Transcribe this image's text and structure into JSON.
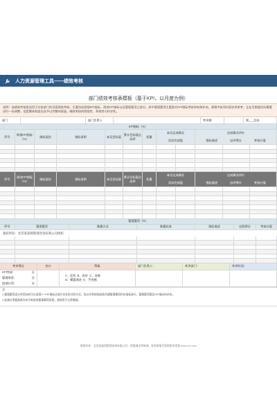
{
  "header": {
    "title": "人力资源管理工具——绩效考核"
  },
  "doc": {
    "title": "部门绩效考核表模板（基于KPI，以月度为例）",
    "description": "说明：该绩效考核表适用于对各部门的月度绩效考核，主要包括常规KPI指标、改进KPI指标以及管理要项三部分，其中管理要项主要是对KPI指标考核的有效补充。表格中各项内容仅供参考，企业可根据实际需要进行一些调整，但是整体框架应该予以完整的保留，确保考核的简规性、系统性与科学性。",
    "info_labels": [
      "部门",
      "部门负责人",
      "考评期",
      "第___月份"
    ],
    "kpi_band": "KPI指标（%）",
    "kpi_cols": [
      "序号",
      "常规KPI指标（%）",
      "指标类别",
      "指标说明",
      "本月目标值",
      "累计目标值达成率",
      "权重",
      "本月达成情况",
      "实际完成值",
      "本期完成值比率（%）",
      "达成情况评价",
      "指标描述",
      "自评得分",
      "考核分值"
    ],
    "kpi_group": "本月达成情况",
    "eval_group": "达成情况评价",
    "improve_first": "改进KPI指标（%）",
    "mgmt_band": "管理要项（%）",
    "mgmt_cols": [
      "序号",
      "管理要项",
      "衡量方法",
      "衡量标准",
      "指标描述",
      "自我得分",
      "考核分值"
    ],
    "watermark": "版权所有：北京某某网管理咨询有限公司授权",
    "summary": {
      "score_label": "考评得分",
      "total_label": "合计",
      "grade_label": "等级",
      "head_label": "部门负责人：",
      "dept_label": "考评部门：",
      "date_label": "考评时间：",
      "rows": [
        "KPI完成：",
        "管理改进：",
        "加减分项："
      ],
      "unit": "分",
      "grades": "A、优秀  B、良好  C、合格\nD、需要改进  E、不合格"
    },
    "notes_title": "注：",
    "notes": [
      "1.管理要项设计时目标的可以采用1一KPI指标达成方式在形式的方式，但公司考核指标和关键管理事项约在指标进行，管理要项需至KPI指标的补充。",
      "2.加减分项要具体为本月有各类管理事项奖惩。具体用于分类增减。"
    ],
    "footer": "版权所有：北京某某网管理咨询有限公司，转载请注明来源。联系客服可获取更多资源 www.xxx.com"
  }
}
